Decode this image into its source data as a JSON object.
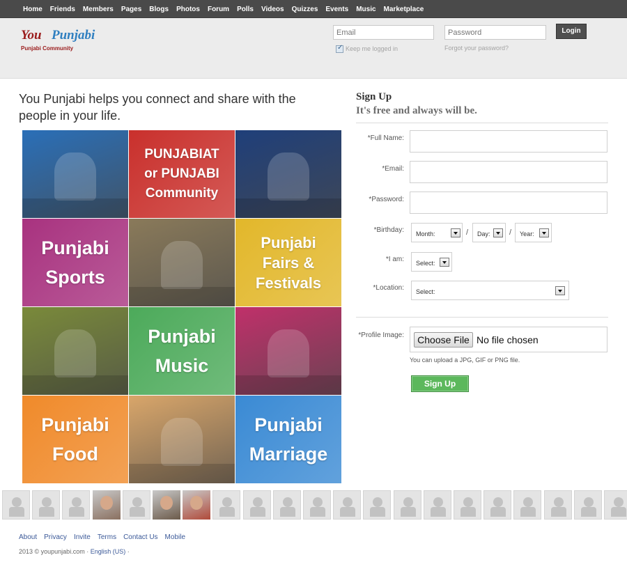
{
  "nav": {
    "items": [
      "Home",
      "Friends",
      "Members",
      "Pages",
      "Blogs",
      "Photos",
      "Forum",
      "Polls",
      "Videos",
      "Quizzes",
      "Events",
      "Music",
      "Marketplace"
    ]
  },
  "header": {
    "logo_you": "You",
    "logo_punjabi": "Punjabi",
    "logo_tagline": "Punjabi Community",
    "email_placeholder": "Email",
    "password_placeholder": "Password",
    "login_label": "Login",
    "keep_logged_in": "Keep me logged in",
    "forgot_password": "Forgot your password?"
  },
  "tagline": "You Punjabi helps you connect and share with the people in your life.",
  "tiles": [
    {
      "kind": "photo",
      "name": "hockey-photo",
      "lines": [],
      "color": "#2a6fb8"
    },
    {
      "kind": "text",
      "name": "punjabiat-tile",
      "lines": [
        "PUNJABIAT",
        "or PUNJABI",
        "Community"
      ],
      "color": "#c9302c"
    },
    {
      "kind": "photo",
      "name": "hockey-night-photo",
      "lines": [],
      "color": "#1f3f7a"
    },
    {
      "kind": "text",
      "name": "punjabi-sports-tile",
      "lines": [
        "Punjabi",
        "Sports"
      ],
      "color": "#a8327f"
    },
    {
      "kind": "photo",
      "name": "bull-race-photo",
      "lines": [],
      "color": "#8a7a5a"
    },
    {
      "kind": "text",
      "name": "fairs-festivals-tile",
      "lines": [
        "Punjabi",
        "Fairs &",
        "Festivals"
      ],
      "color": "#e2b72a"
    },
    {
      "kind": "photo",
      "name": "bhangra-dance-photo",
      "lines": [],
      "color": "#7a8a3a"
    },
    {
      "kind": "text",
      "name": "punjabi-music-tile",
      "lines": [
        "Punjabi",
        "Music"
      ],
      "color": "#4caa5a"
    },
    {
      "kind": "photo",
      "name": "wedding-couple-photo",
      "lines": [],
      "color": "#c0306a"
    },
    {
      "kind": "text",
      "name": "punjabi-food-tile",
      "lines": [
        "Punjabi",
        "Food"
      ],
      "color": "#f08a2a"
    },
    {
      "kind": "photo",
      "name": "chicken-dish-photo",
      "lines": [],
      "color": "#d9a66a"
    },
    {
      "kind": "text",
      "name": "punjabi-marriage-tile",
      "lines": [
        "Punjabi",
        "Marriage"
      ],
      "color": "#3a8ad4"
    }
  ],
  "signup": {
    "title": "Sign Up",
    "subtitle": "It's free and always will be.",
    "full_name_label": "*Full Name:",
    "email_label": "*Email:",
    "password_label": "*Password:",
    "birthday_label": "*Birthday:",
    "month": "Month:",
    "day": "Day:",
    "year": "Year:",
    "slash": "/",
    "i_am_label": "*I am:",
    "i_am_value": "Select:",
    "location_label": "*Location:",
    "location_value": "Select:",
    "profile_image_label": "*Profile Image:",
    "choose_file": "Choose File",
    "no_file": "No file chosen",
    "upload_hint": "You can upload a JPG, GIF or PNG file.",
    "button": "Sign Up"
  },
  "avatar_photos": [
    3,
    5,
    6
  ],
  "footer": {
    "links": [
      "About",
      "Privacy",
      "Invite",
      "Terms",
      "Contact Us",
      "Mobile"
    ],
    "copyright": "2013 © youpunjabi.com ·",
    "language": "English (US)",
    "trail": "·"
  }
}
